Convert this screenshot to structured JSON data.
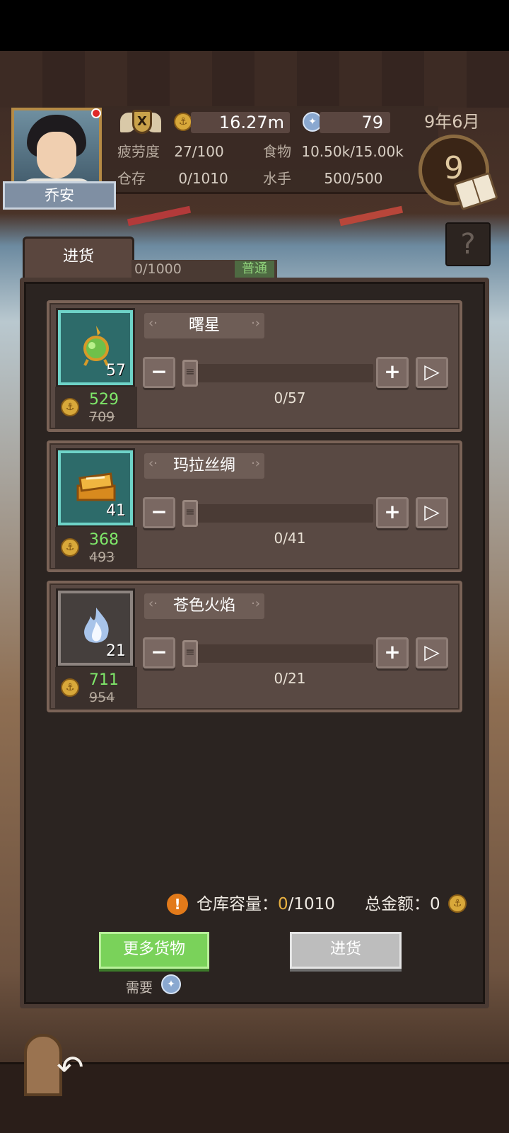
{
  "hud": {
    "character_name": "乔安",
    "rank_letter": "X",
    "money": "16.27m",
    "medals": "79",
    "date": "9年6月",
    "day": "9",
    "stats": {
      "fatigue_label": "疲劳度",
      "fatigue_value": "27/100",
      "food_label": "食物",
      "food_value": "10.50k/15.00k",
      "storage_label": "仓存",
      "storage_value": "0/1010",
      "sailors_label": "水手",
      "sailors_value": "500/500"
    },
    "help": "?"
  },
  "tab": {
    "label": "进货",
    "capacity_text": "0/1000",
    "level_label": "普通"
  },
  "items": [
    {
      "name": "曙星",
      "stock": "57",
      "price": "529",
      "old_price": "709",
      "qty": "0/57",
      "icon": "green-lantern-icon",
      "frame": "teal"
    },
    {
      "name": "玛拉丝绸",
      "stock": "41",
      "price": "368",
      "old_price": "493",
      "qty": "0/41",
      "icon": "gold-silk-icon",
      "frame": "teal"
    },
    {
      "name": "苍色火焰",
      "stock": "21",
      "price": "711",
      "old_price": "954",
      "qty": "0/21",
      "icon": "blue-flame-icon",
      "frame": "gray"
    }
  ],
  "controls": {
    "minus": "−",
    "plus": "+",
    "max": "▷"
  },
  "footer": {
    "capacity_label": "仓库容量：",
    "capacity_used": "0",
    "capacity_total": "/1010",
    "total_label": "总金额：",
    "total_value": "0",
    "more_button": "更多货物",
    "need_label": "需要",
    "buy_button": "进货"
  },
  "colors": {
    "price_green": "#7fe86a",
    "more_green": "#7ad25a",
    "warn_orange": "#e27a1a"
  }
}
